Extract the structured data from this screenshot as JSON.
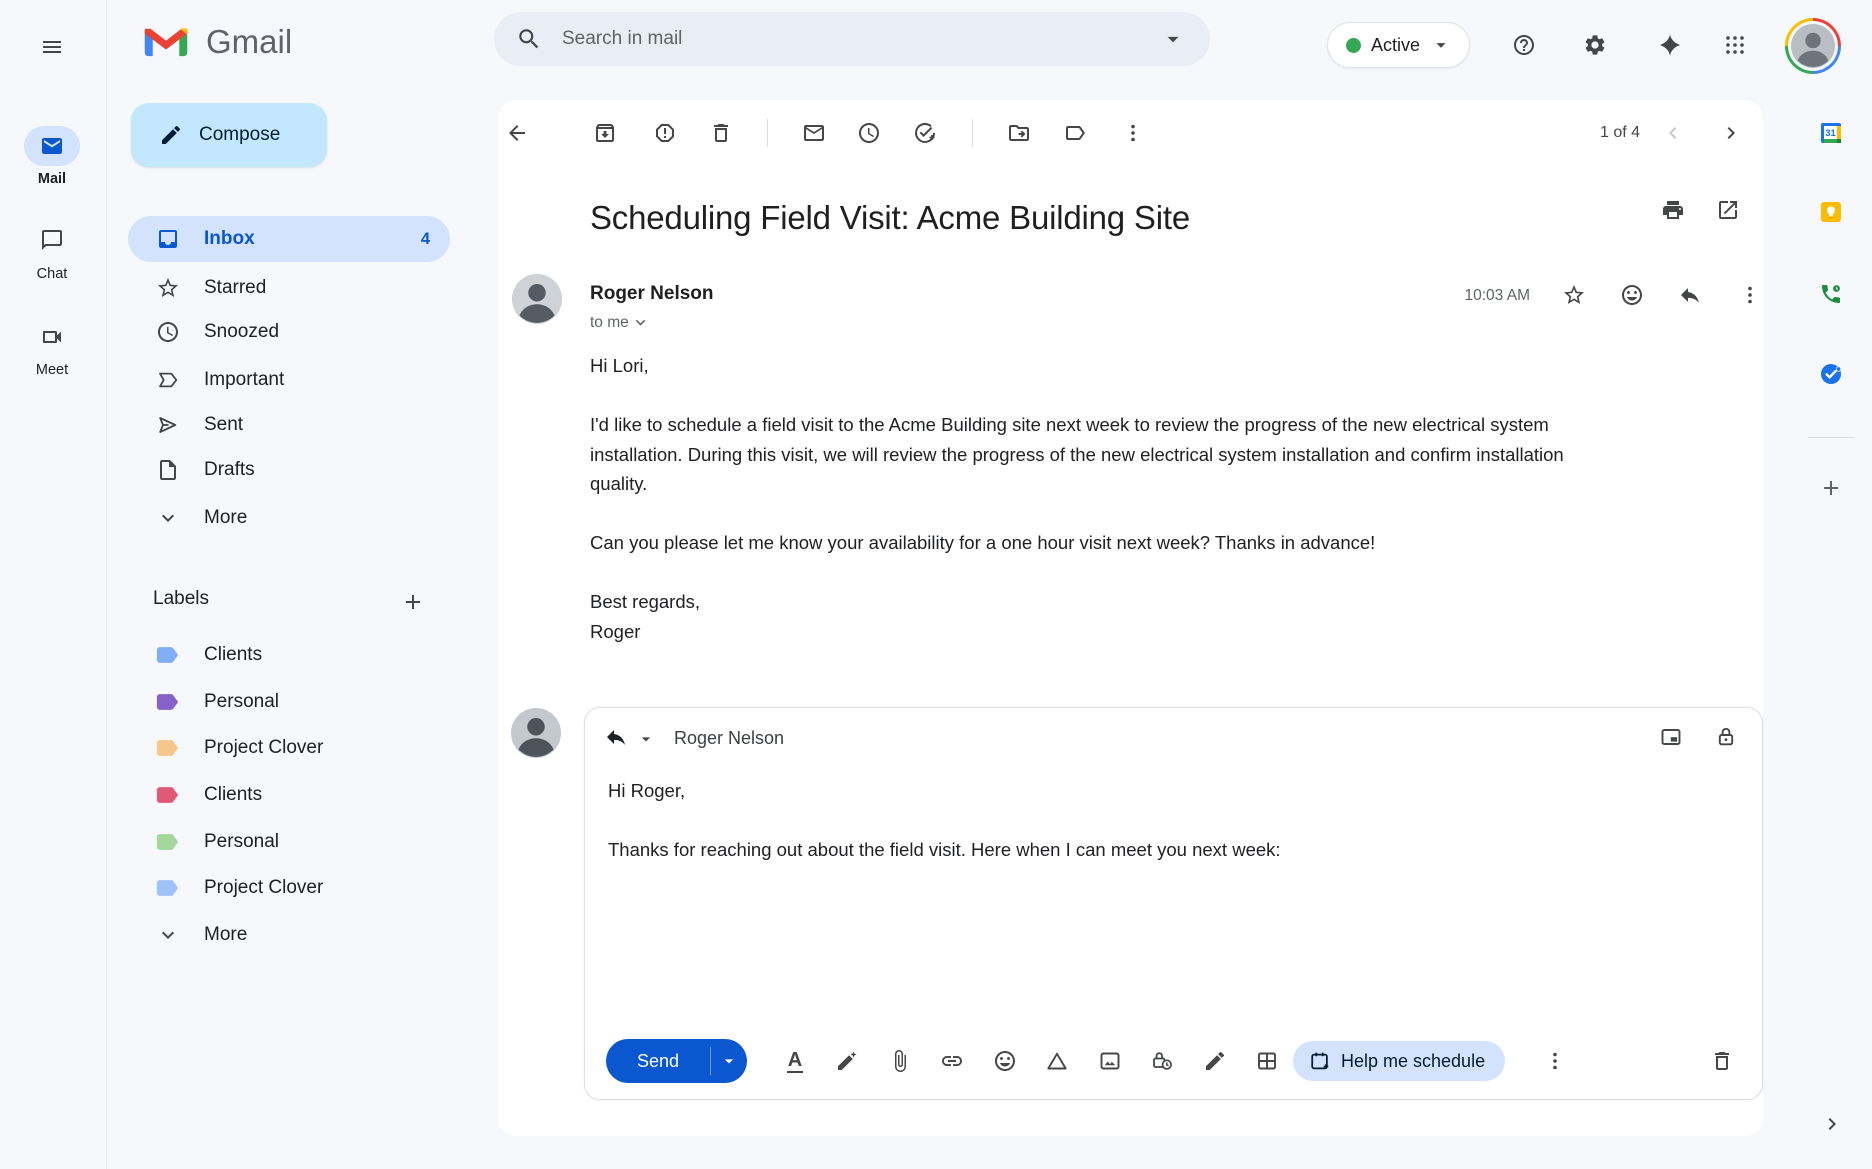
{
  "rail": {
    "items": [
      {
        "label": "Mail"
      },
      {
        "label": "Chat"
      },
      {
        "label": "Meet"
      }
    ]
  },
  "sidebar": {
    "logo_text": "Gmail",
    "compose_label": "Compose",
    "nav": [
      {
        "label": "Inbox",
        "count": "4"
      },
      {
        "label": "Starred"
      },
      {
        "label": "Snoozed"
      },
      {
        "label": "Important"
      },
      {
        "label": "Sent"
      },
      {
        "label": "Drafts"
      },
      {
        "label": "More"
      }
    ],
    "labels_header": "Labels",
    "labels": [
      {
        "name": "Clients",
        "color": "#81aef7"
      },
      {
        "name": "Personal",
        "color": "#8760c9"
      },
      {
        "name": "Project Clover",
        "color": "#f6c78b"
      },
      {
        "name": "Clients",
        "color": "#e05975"
      },
      {
        "name": "Personal",
        "color": "#a3d79c"
      },
      {
        "name": "Project Clover",
        "color": "#9fc1f7"
      }
    ],
    "labels_more": "More"
  },
  "topbar": {
    "search_placeholder": "Search in mail",
    "status_label": "Active"
  },
  "message": {
    "pagination": "1 of 4",
    "subject": "Scheduling Field Visit: Acme Building Site",
    "sender_name": "Roger Nelson",
    "recipient_label": "to me",
    "time": "10:03 AM",
    "body_lines": [
      "Hi Lori,",
      "",
      "I'd like to schedule a field visit to the Acme Building site next week to review the progress of the new electrical system",
      "installation. During this visit, we will review the progress of the new electrical system installation and confirm installation",
      "quality.",
      "",
      "Can you please let me know your availability for a one hour visit next week? Thanks in advance!",
      "",
      "Best regards,",
      "Roger"
    ]
  },
  "reply": {
    "to_name": "Roger Nelson",
    "body_lines": [
      "Hi Roger,",
      "",
      "Thanks for reaching out about the field visit. Here when I can meet you next week:"
    ],
    "send_label": "Send",
    "schedule_label": "Help me schedule"
  },
  "colors": {
    "accent": "#0b57d0",
    "selection": "#d3e3fd",
    "compose_button": "#c2e7ff",
    "status_green": "#34a853"
  }
}
